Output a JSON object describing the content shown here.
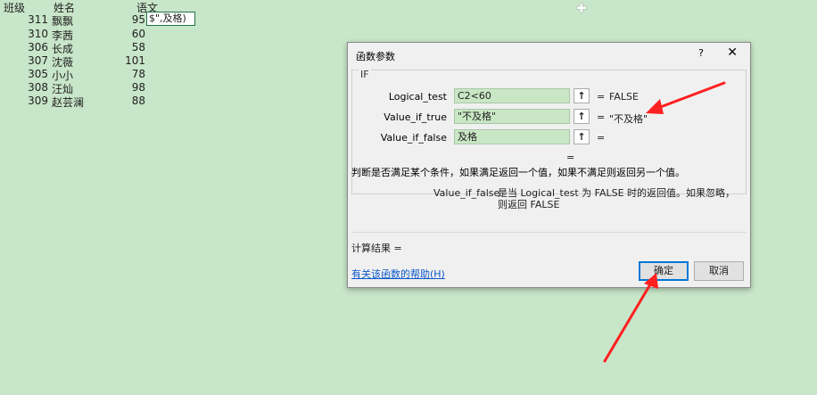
{
  "sheet": {
    "headers": {
      "class": "班级",
      "name": "姓名",
      "score": "语文"
    },
    "rows": [
      {
        "class": "311",
        "name": "飘飘",
        "score": "95"
      },
      {
        "class": "310",
        "name": "李茜",
        "score": "60"
      },
      {
        "class": "306",
        "name": "长成",
        "score": "58"
      },
      {
        "class": "307",
        "name": "沈薇",
        "score": "101"
      },
      {
        "class": "305",
        "name": "小小",
        "score": "78"
      },
      {
        "class": "308",
        "name": "汪灿",
        "score": "98"
      },
      {
        "class": "309",
        "name": "赵芸澜",
        "score": "88"
      }
    ],
    "active_cell_value": "$\",及格)"
  },
  "dialog": {
    "title": "函数参数",
    "help_icon": "?",
    "close_icon": "✕",
    "function_name": "IF",
    "args": [
      {
        "label": "Logical_test",
        "value": "C2<60",
        "eq": "=",
        "result": "FALSE"
      },
      {
        "label": "Value_if_true",
        "value": "\"不及格\"",
        "eq": "=",
        "result": "\"不及格\""
      },
      {
        "label": "Value_if_false",
        "value": "及格",
        "eq": "=",
        "result": ""
      }
    ],
    "collapse_glyph": "↑",
    "lone_eq": "=",
    "description": "判断是否满足某个条件，如果满足返回一个值，如果不满足则返回另一个值。",
    "arg_desc_name": "Value_if_false",
    "arg_desc": "是当 Logical_test 为 FALSE 时的返回值。如果忽略，则返回 FALSE",
    "calc_result_label": "计算结果 =",
    "help_link": "有关该函数的帮助(H)",
    "ok_label": "确定",
    "cancel_label": "取消"
  },
  "colors": {
    "sheet_bg": "#c8e6c9",
    "input_bg": "#c9e7c4",
    "arrow": "#ff2020",
    "link": "#0b58c8"
  }
}
